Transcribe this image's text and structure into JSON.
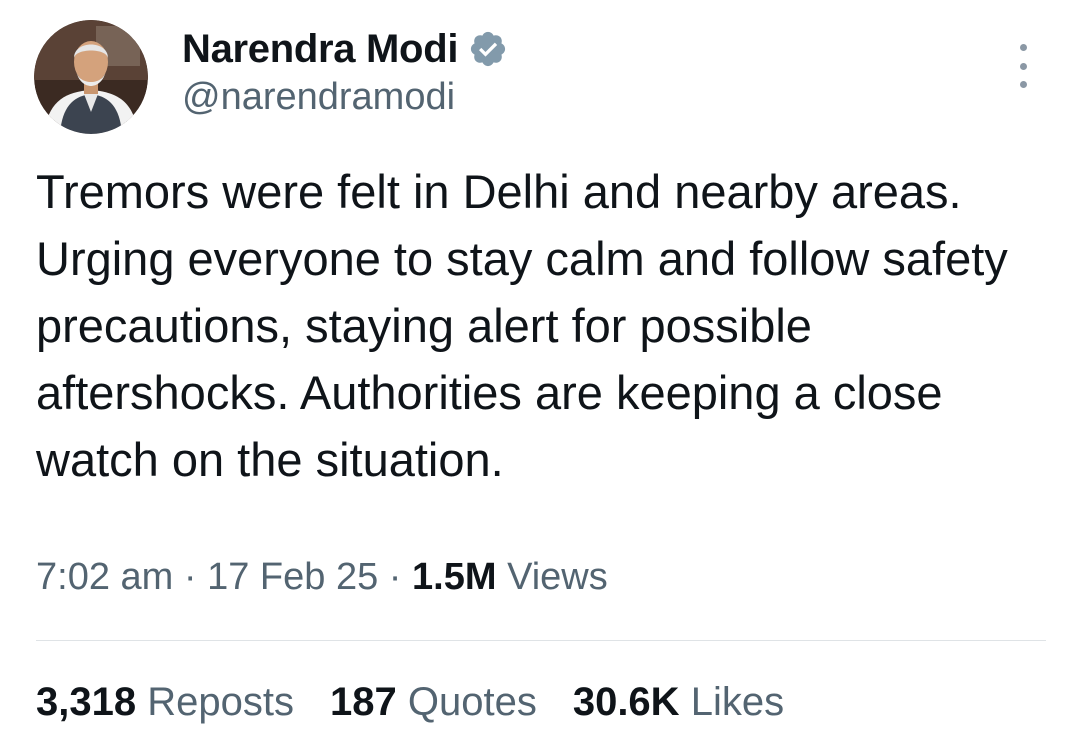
{
  "author": {
    "name": "Narendra Modi",
    "handle": "@narendramodi",
    "verified_icon": "verified-badge-icon"
  },
  "tweet": {
    "text": "Tremors were felt in Delhi and nearby areas. Urging everyone to stay calm and follow safety precautions, staying alert for possible aftershocks. Authorities are keeping a close watch on the situation."
  },
  "meta": {
    "time": "7:02 am",
    "separator": "·",
    "date": "17 Feb 25",
    "views_count": "1.5M",
    "views_label": "Views"
  },
  "stats": {
    "reposts_count": "3,318",
    "reposts_label": "Reposts",
    "quotes_count": "187",
    "quotes_label": "Quotes",
    "likes_count": "30.6K",
    "likes_label": "Likes"
  },
  "colors": {
    "primary_text": "#0f1419",
    "secondary_text": "#536471",
    "verified_badge": "#829aab",
    "divider": "#dfe3e6"
  }
}
